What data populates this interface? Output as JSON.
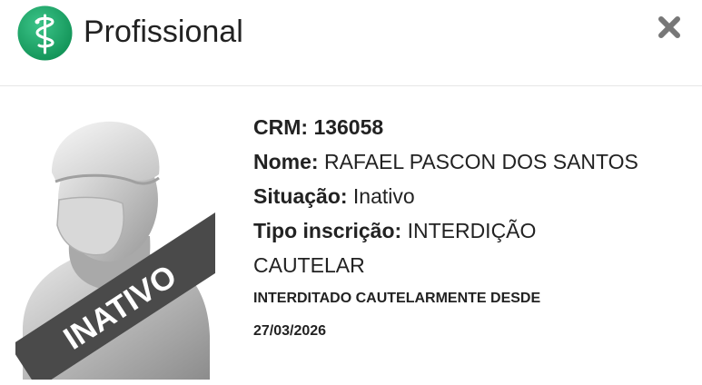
{
  "header": {
    "title": "Profissional",
    "logo_icon": "caduceus-icon",
    "close_icon": "close-icon",
    "logo_color": "#1aa566"
  },
  "profile": {
    "photo_icon": "doctor-silhouette-icon",
    "badge_text": "INATIVO",
    "crm_label": "CRM:",
    "crm_value": "136058",
    "nome_label": "Nome:",
    "nome_value": "RAFAEL PASCON DOS SANTOS",
    "situacao_label": "Situação:",
    "situacao_value": "Inativo",
    "tipo_label": "Tipo inscrição:",
    "tipo_value_1": "INTERDIÇÃO",
    "tipo_value_2": "CAUTELAR",
    "note_1": "INTERDITADO CAUTELARMENTE DESDE",
    "note_2": "27/03/2026"
  }
}
